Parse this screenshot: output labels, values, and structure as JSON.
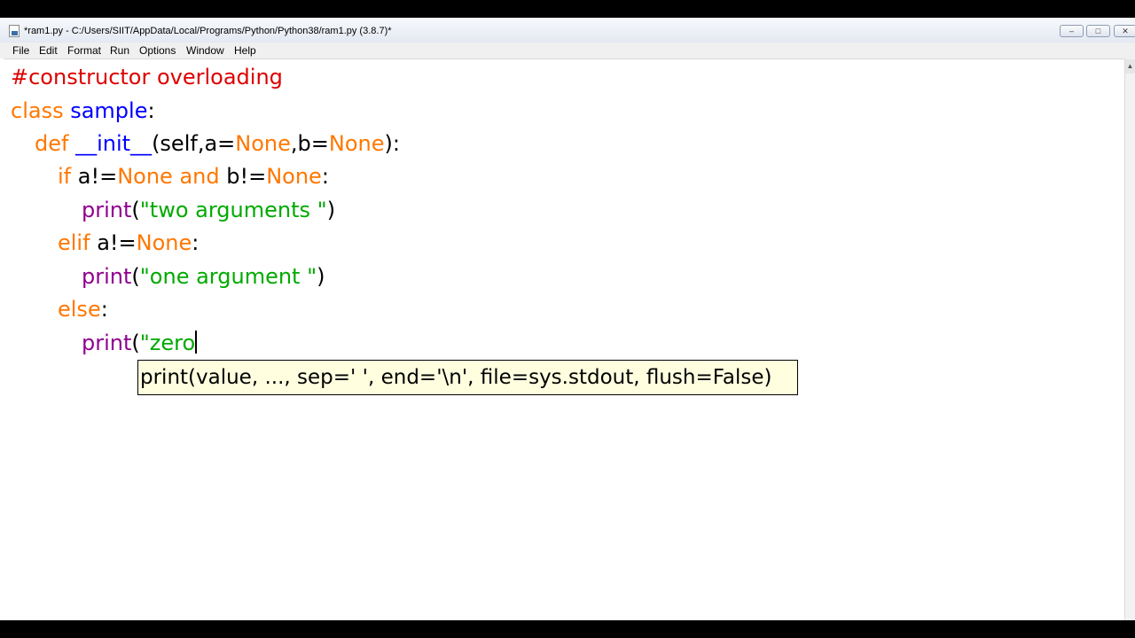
{
  "window": {
    "title": "*ram1.py - C:/Users/SIIT/AppData/Local/Programs/Python/Python38/ram1.py (3.8.7)*",
    "controls": {
      "minimize": "–",
      "maximize": "□",
      "close": "✕"
    }
  },
  "menu": [
    "File",
    "Edit",
    "Format",
    "Run",
    "Options",
    "Window",
    "Help"
  ],
  "code": {
    "line1": {
      "comment": "#constructor overloading"
    },
    "line2": {
      "kw": "class",
      "name": "sample",
      "rest": ":"
    },
    "line3": {
      "kw": "def",
      "name": "__init__",
      "p1": "(self,a=",
      "n1": "None",
      "p2": ",b=",
      "n2": "None",
      "p3": "):"
    },
    "line4": {
      "kw": "if",
      "t1": " a!=",
      "n1": "None",
      "and": " and",
      "t2": " b!=",
      "n2": "None",
      "t3": ":"
    },
    "line5": {
      "fn": "print",
      "open": "(",
      "str": "\"two arguments \"",
      "close": ")"
    },
    "line6": {
      "kw": "elif",
      "t1": " a!=",
      "n1": "None",
      "t2": ":"
    },
    "line7": {
      "fn": "print",
      "open": "(",
      "str": "\"one argument \"",
      "close": ")"
    },
    "line8": {
      "kw": "else",
      "t1": ":"
    },
    "line9": {
      "fn": "print",
      "open": "(",
      "str": "\"zero"
    }
  },
  "calltip": {
    "text": "print(value, ..., sep=' ', end='\\n', file=sys.stdout, flush=False)"
  }
}
